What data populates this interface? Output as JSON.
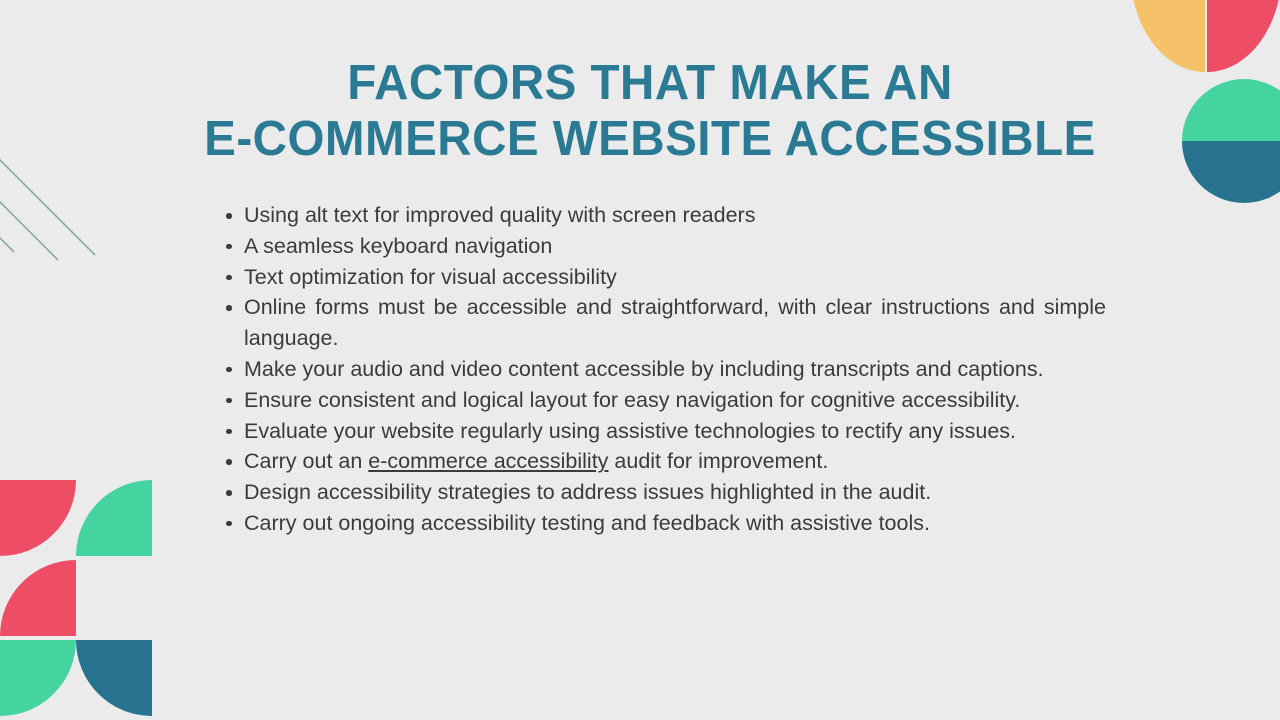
{
  "slide": {
    "background_color": "#ebebeb",
    "title": {
      "color": "#2a7a94",
      "line1": "FACTORS THAT MAKE AN",
      "line2": "E-COMMERCE WEBSITE ACCESSIBLE"
    },
    "body": {
      "text_color": "#3b3b3b",
      "bullets": [
        {
          "text": "Using alt text for improved quality with screen readers",
          "single_line": true
        },
        {
          "text": "A seamless keyboard navigation",
          "single_line": true
        },
        {
          "text": "Text optimization for visual accessibility",
          "single_line": true
        },
        {
          "text": "Online forms must be accessible and straightforward, with clear instructions and simple language.",
          "single_line": false
        },
        {
          "text": "Make your audio and video content accessible by including transcripts and captions.",
          "single_line": false
        },
        {
          "text": "Ensure consistent and logical layout for easy navigation for cognitive accessibility.",
          "single_line": false
        },
        {
          "text": "Evaluate your website regularly using assistive technologies to rectify any issues.",
          "single_line": false
        },
        {
          "text_before_link": "Carry out an ",
          "link_text": "e-commerce accessibility",
          "text_after_link": " audit for improvement.",
          "single_line": true,
          "has_link": true
        },
        {
          "text": "Design accessibility strategies to address issues highlighted in the audit.",
          "single_line": false
        },
        {
          "text": "Carry out ongoing accessibility testing and feedback with assistive tools.",
          "single_line": false
        }
      ]
    },
    "decorations": {
      "colors": {
        "yellow": "#f5c269",
        "red": "#ed4d65",
        "green": "#45d4a0",
        "teal": "#27738f",
        "line_gray": "#8aa8a6"
      },
      "top_right": [
        {
          "name": "yellow-quarter-circle",
          "color": "#f5c269"
        },
        {
          "name": "red-quarter-circle",
          "color": "#ed4d65"
        },
        {
          "name": "split-circle-green-teal",
          "color_top": "#45d4a0",
          "color_bottom": "#27738f"
        }
      ],
      "bottom_left": [
        {
          "name": "red-quarter-tile",
          "color": "#ed4d65"
        },
        {
          "name": "green-quarter-tile",
          "color": "#45d4a0"
        },
        {
          "name": "red-quarter-tile-2",
          "color": "#ed4d65"
        },
        {
          "name": "green-quarter-tile-2",
          "color": "#45d4a0"
        },
        {
          "name": "teal-quarter-tile",
          "color": "#27738f"
        }
      ],
      "upper_left_lines": {
        "name": "diagonal-accent-lines",
        "count": 3,
        "color": "#8aa8a6"
      }
    }
  }
}
